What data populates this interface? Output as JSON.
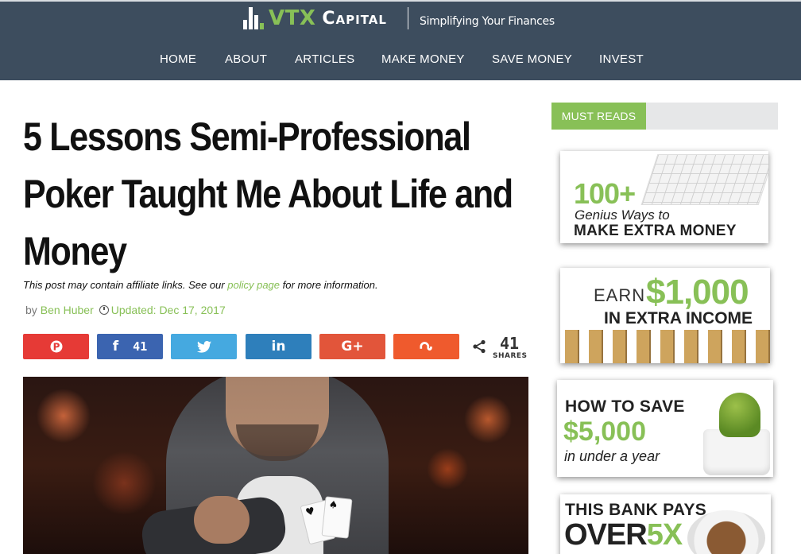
{
  "site": {
    "logo_primary": "VTX",
    "logo_secondary": "Capital",
    "tagline": "Simplifying Your Finances"
  },
  "nav": {
    "items": [
      "HOME",
      "ABOUT",
      "ARTICLES",
      "MAKE MONEY",
      "SAVE MONEY",
      "INVEST"
    ]
  },
  "article": {
    "title": "5 Lessons Semi-Professional Poker Taught Me About Life and Money",
    "disclosure_prefix": "This post may contain affiliate links. See our",
    "disclosure_link": "policy page",
    "disclosure_suffix": "for more information.",
    "by_label": "by",
    "author": "Ben Huber",
    "updated": "Updated: Dec 17, 2017"
  },
  "share": {
    "facebook_count": "41",
    "total_count": "41",
    "total_label": "SHARES",
    "buttons": [
      {
        "network": "pinterest",
        "icon": "pinterest-icon",
        "color": "#e63a36"
      },
      {
        "network": "facebook",
        "icon": "facebook-icon",
        "color": "#3b64b0"
      },
      {
        "network": "twitter",
        "icon": "twitter-icon",
        "color": "#45a9e0"
      },
      {
        "network": "linkedin",
        "icon": "linkedin-icon",
        "color": "#2e7fbb"
      },
      {
        "network": "google-plus",
        "icon": "google-plus-icon",
        "color": "#e2553a"
      },
      {
        "network": "stumbleupon",
        "icon": "stumbleupon-icon",
        "color": "#ef5a2d"
      }
    ]
  },
  "sidebar": {
    "heading": "MUST READS",
    "promos": [
      {
        "line1": "100+",
        "line2": "Genius Ways to",
        "line3": "MAKE EXTRA MONEY"
      },
      {
        "line1": "EARN",
        "line2": "$1,000",
        "line3": "IN EXTRA INCOME"
      },
      {
        "line1": "HOW TO SAVE",
        "line2": "$5,000",
        "line3": "in under a year"
      },
      {
        "line1": "THIS BANK PAYS",
        "line2": "OVER",
        "line3": "5X"
      }
    ]
  },
  "colors": {
    "header_bg": "#3d4d5e",
    "accent_green": "#88c057",
    "title_text": "#111111"
  }
}
